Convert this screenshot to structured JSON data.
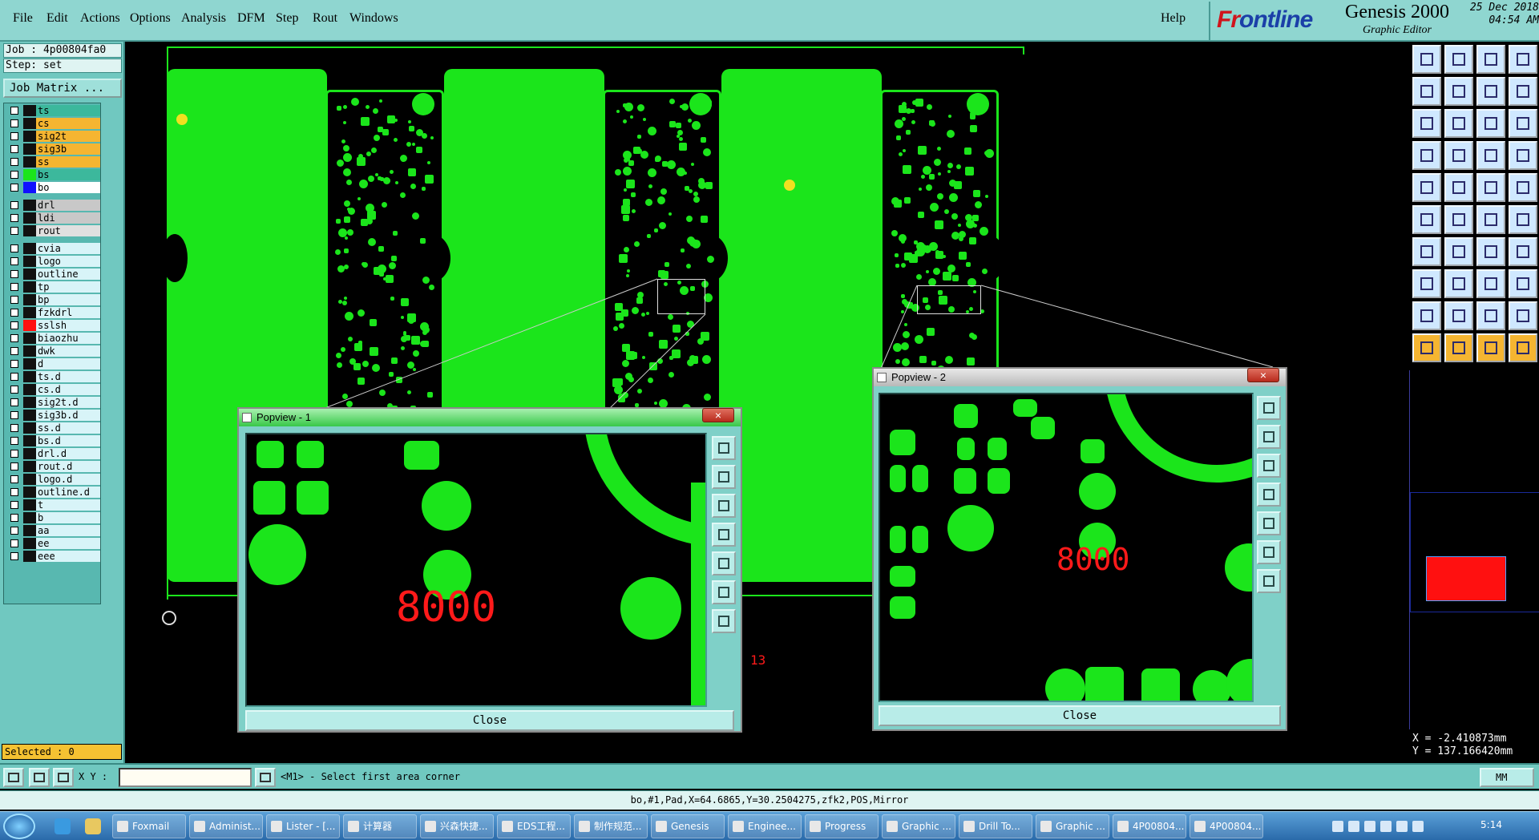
{
  "menu": {
    "items": [
      "File",
      "Edit",
      "Actions",
      "Options",
      "Analysis",
      "DFM",
      "Step",
      "Rout",
      "Windows"
    ],
    "help": "Help"
  },
  "brand": {
    "logo_prefix": "Fr",
    "logo_main": "ontline",
    "product": "Genesis 2000",
    "subtitle": "Graphic Editor",
    "date": "25 Dec 2018",
    "time": "04:54 AM"
  },
  "left": {
    "job": "Job : 4p00804fa0",
    "step": "Step: set",
    "job_matrix": "Job Matrix ...",
    "selected": "Selected : 0"
  },
  "layers": [
    {
      "name": "ts",
      "color": "#3cb89c",
      "swatch": "#111"
    },
    {
      "name": "cs",
      "color": "#f5b531",
      "swatch": "#111"
    },
    {
      "name": "sig2t",
      "color": "#f5b531",
      "swatch": "#111"
    },
    {
      "name": "sig3b",
      "color": "#f5b531",
      "swatch": "#111"
    },
    {
      "name": "ss",
      "color": "#f5b531",
      "swatch": "#111"
    },
    {
      "name": "bs",
      "color": "#3cb89c",
      "swatch": "#1be51b"
    },
    {
      "name": "bo",
      "color": "#ffffff",
      "swatch": "#1010ff"
    },
    {
      "name": "drl",
      "color": "#c8c8c8",
      "swatch": "#111"
    },
    {
      "name": "ldi",
      "color": "#c8c8c8",
      "swatch": "#111"
    },
    {
      "name": "rout",
      "color": "#e0e0e0",
      "swatch": "#111"
    },
    {
      "name": "cvia",
      "color": "#d8f4f8",
      "swatch": "#111"
    },
    {
      "name": "logo",
      "color": "#d8f4f8",
      "swatch": "#111"
    },
    {
      "name": "outline",
      "color": "#d8f4f8",
      "swatch": "#111"
    },
    {
      "name": "tp",
      "color": "#d8f4f8",
      "swatch": "#111"
    },
    {
      "name": "bp",
      "color": "#d8f4f8",
      "swatch": "#111"
    },
    {
      "name": "fzkdrl",
      "color": "#d8f4f8",
      "swatch": "#111"
    },
    {
      "name": "sslsh",
      "color": "#d8f4f8",
      "swatch": "#ff1010"
    },
    {
      "name": "biaozhu",
      "color": "#d8f4f8",
      "swatch": "#111"
    },
    {
      "name": "dwk",
      "color": "#d8f4f8",
      "swatch": "#111"
    },
    {
      "name": "d",
      "color": "#d8f4f8",
      "swatch": "#111"
    },
    {
      "name": "ts.d",
      "color": "#d8f4f8",
      "swatch": "#111"
    },
    {
      "name": "cs.d",
      "color": "#d8f4f8",
      "swatch": "#111"
    },
    {
      "name": "sig2t.d",
      "color": "#d8f4f8",
      "swatch": "#111"
    },
    {
      "name": "sig3b.d",
      "color": "#d8f4f8",
      "swatch": "#111"
    },
    {
      "name": "ss.d",
      "color": "#d8f4f8",
      "swatch": "#111"
    },
    {
      "name": "bs.d",
      "color": "#d8f4f8",
      "swatch": "#111"
    },
    {
      "name": "drl.d",
      "color": "#d8f4f8",
      "swatch": "#111"
    },
    {
      "name": "rout.d",
      "color": "#d8f4f8",
      "swatch": "#111"
    },
    {
      "name": "logo.d",
      "color": "#d8f4f8",
      "swatch": "#111"
    },
    {
      "name": "outline.d",
      "color": "#d8f4f8",
      "swatch": "#111"
    },
    {
      "name": "t",
      "color": "#d8f4f8",
      "swatch": "#111"
    },
    {
      "name": "b",
      "color": "#d8f4f8",
      "swatch": "#111"
    },
    {
      "name": "aa",
      "color": "#d8f4f8",
      "swatch": "#111"
    },
    {
      "name": "ee",
      "color": "#d8f4f8",
      "swatch": "#111"
    },
    {
      "name": "eee",
      "color": "#d8f4f8",
      "swatch": "#111"
    }
  ],
  "popview1": {
    "title": "Popview - 1",
    "label": "8000",
    "close": "Close",
    "x_icon": "×"
  },
  "popview2": {
    "title": "Popview - 2",
    "label": "8000",
    "close": "Close",
    "x_icon": "×"
  },
  "canvas": {
    "marker": "13"
  },
  "coords": {
    "x": "X = -2.410873mm",
    "y": "Y = 137.166420mm"
  },
  "cmd": {
    "xy_label": "X Y :",
    "xy_value": "",
    "prompt": "<M1> - Select first area corner",
    "unit": "MM"
  },
  "status": "bo,#1,Pad,X=64.6865,Y=30.2504275,zfk2,POS,Mirror",
  "taskbar": {
    "tasks": [
      "Foxmail",
      "Administ...",
      "Lister - [...",
      "计算器",
      "兴森快捷...",
      "EDS工程...",
      "制作规范...",
      "Genesis",
      "Enginee...",
      "Progress",
      "Graphic ...",
      "Drill To...",
      "Graphic ...",
      "4P00804...",
      "4P00804..."
    ],
    "clock": "5:14"
  },
  "colors": {
    "accent": "#8fd6d0",
    "copper": "#1be51b",
    "highlight": "#ff1a1a"
  }
}
